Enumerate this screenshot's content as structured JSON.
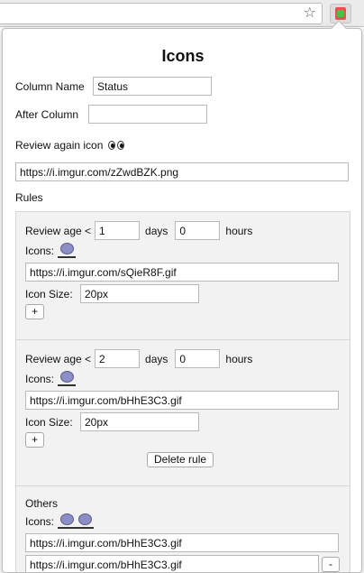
{
  "popup": {
    "title": "Icons",
    "column_name_label": "Column Name",
    "column_name_value": "Status",
    "after_column_label": "After Column",
    "after_column_value": "",
    "review_again_label": "Review again icon",
    "review_again_url": "https://i.imgur.com/zZwdBZK.png",
    "rules_label": "Rules",
    "rules": [
      {
        "review_age_label": "Review age <",
        "days_value": "1",
        "days_label": "days",
        "hours_value": "0",
        "hours_label": "hours",
        "icons_label": "Icons:",
        "icon_urls": [
          "https://i.imgur.com/sQieR8F.gif"
        ],
        "icon_size_label": "Icon Size:",
        "icon_size_value": "20px",
        "add_label": "+"
      },
      {
        "review_age_label": "Review age <",
        "days_value": "2",
        "days_label": "days",
        "hours_value": "0",
        "hours_label": "hours",
        "icons_label": "Icons:",
        "icon_urls": [
          "https://i.imgur.com/bHhE3C3.gif"
        ],
        "icon_size_label": "Icon Size:",
        "icon_size_value": "20px",
        "add_label": "+",
        "delete_label": "Delete rule"
      }
    ],
    "others": {
      "title": "Others",
      "icons_label": "Icons:",
      "icon_urls": [
        "https://i.imgur.com/bHhE3C3.gif",
        "https://i.imgur.com/bHhE3C3.gif"
      ],
      "remove_label": "-"
    }
  },
  "icons": {
    "star": "star-icon",
    "extension": "extension-icon",
    "eyes": "eyes-icon",
    "blob": "blob-icon"
  }
}
